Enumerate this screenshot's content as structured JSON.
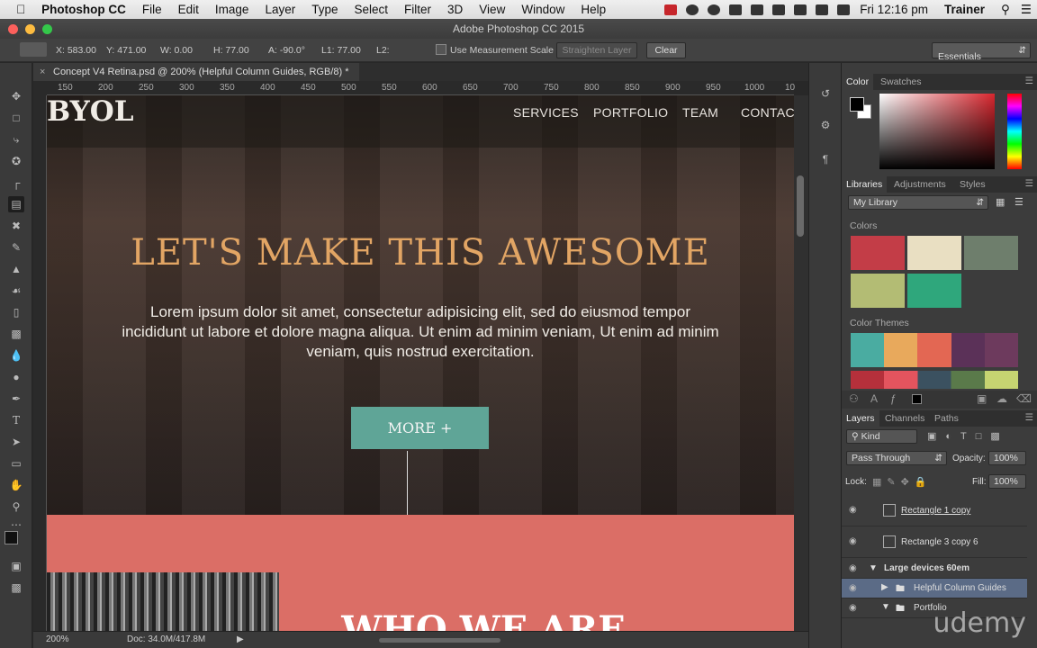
{
  "menubar": {
    "items": [
      "Photoshop CC",
      "File",
      "Edit",
      "Image",
      "Layer",
      "Type",
      "Select",
      "Filter",
      "3D",
      "View",
      "Window",
      "Help"
    ],
    "clock": "Fri 12:16 pm",
    "user": "Trainer"
  },
  "titlebar": {
    "title": "Adobe Photoshop CC 2015"
  },
  "options": {
    "x": "X: 583.00",
    "y": "Y: 471.00",
    "w": "W: 0.00",
    "h": "H: 77.00",
    "a": "A: -90.0°",
    "l1": "L1: 77.00",
    "l2": "L2:",
    "measurement_label": "Use Measurement Scale",
    "straighten": "Straighten Layer",
    "clear": "Clear",
    "workspace": "Essentials"
  },
  "document": {
    "tab_title": "Concept V4 Retina.psd @ 200% (Helpful Column Guides, RGB/8) *",
    "ruler_ticks": [
      "150",
      "200",
      "250",
      "300",
      "350",
      "400",
      "450",
      "500",
      "550",
      "600",
      "650",
      "700",
      "750",
      "800",
      "850",
      "900",
      "950",
      "1000",
      "10"
    ]
  },
  "canvas": {
    "logo": "BYOL",
    "nav": [
      "SERVICES",
      "PORTFOLIO",
      "TEAM",
      "CONTACT"
    ],
    "headline": "LET'S MAKE THIS AWESOME",
    "lead": "Lorem ipsum dolor sit amet, consectetur adipisicing elit, sed do eiusmod tempor incididunt ut labore et dolore magna aliqua. Ut enim ad minim veniam, Ut enim ad minim veniam, quis nostrud exercitation.",
    "button": "MORE +",
    "section_title": "WHO WE ARE"
  },
  "status": {
    "zoom": "200%",
    "doc": "Doc: 34.0M/417.8M"
  },
  "color_panel": {
    "tabs": [
      "Color",
      "Swatches"
    ]
  },
  "libraries": {
    "tabs": [
      "Libraries",
      "Adjustments",
      "Styles"
    ],
    "library": "My Library",
    "colors_label": "Colors",
    "colors": [
      "#c33d47",
      "#e9dfc2",
      "#6e7e6c",
      "#b3bc74",
      "#2fa77c"
    ],
    "themes_label": "Color Themes",
    "themes": [
      "#4aaca1",
      "#e8a95c",
      "#e36753",
      "#5b3158",
      "#6d3a5d"
    ]
  },
  "layers": {
    "tabs": [
      "Layers",
      "Channels",
      "Paths"
    ],
    "kind": "Kind",
    "blend": "Pass Through",
    "opacity_label": "Opacity:",
    "opacity": "100%",
    "lock_label": "Lock:",
    "fill_label": "Fill:",
    "fill": "100%",
    "rows": [
      "Rectangle 1 copy",
      "Rectangle 3 copy 6",
      "Large devices 60em",
      "Helpful Column Guides",
      "Portfolio"
    ]
  },
  "watermark": "udemy"
}
